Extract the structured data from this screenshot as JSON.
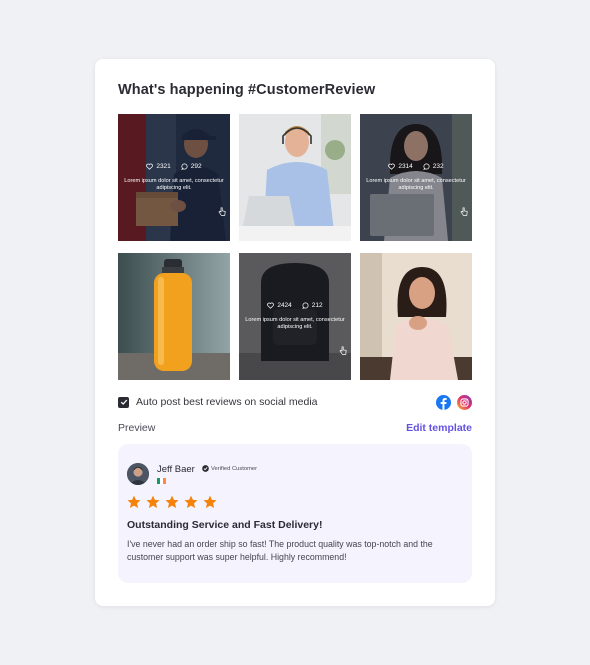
{
  "widget": {
    "title": "What's happening #CustomerReview"
  },
  "tiles": [
    {
      "id": "delivery-man",
      "hovered": true,
      "likes": "2321",
      "comments": "292",
      "caption": "Lorem ipsum dolor sit amet, consectetur adipiscing elit."
    },
    {
      "id": "headset-man",
      "hovered": false
    },
    {
      "id": "woman-laptop",
      "hovered": true,
      "likes": "2314",
      "comments": "232",
      "caption": "Lorem ipsum dolor sit amet, consectetur adipiscing elit."
    },
    {
      "id": "yellow-bottle",
      "hovered": false
    },
    {
      "id": "black-backpack",
      "hovered": true,
      "likes": "2424",
      "comments": "212",
      "caption": "Lorem ipsum dolor sit amet, consectetur adipiscing elit."
    },
    {
      "id": "smiling-woman",
      "hovered": false
    }
  ],
  "autopost": {
    "checked": true,
    "label": "Auto post best reviews on social media",
    "icons": [
      "facebook-icon",
      "instagram-icon"
    ]
  },
  "preview": {
    "label": "Preview",
    "edit_label": "Edit template"
  },
  "review": {
    "name": "Jeff Baer",
    "verified_label": "Verified Customer",
    "flag": "ireland-flag",
    "rating": 5,
    "star_color": "#f5820b",
    "title": "Outstanding Service and Fast Delivery!",
    "body": "I've never had an order ship so fast! The product quality was top-notch and the customer support was super helpful. Highly recommend!"
  },
  "colors": {
    "accent": "#6452e0",
    "review_bg": "#f5f3fd",
    "page_bg": "#f0f1f5"
  }
}
